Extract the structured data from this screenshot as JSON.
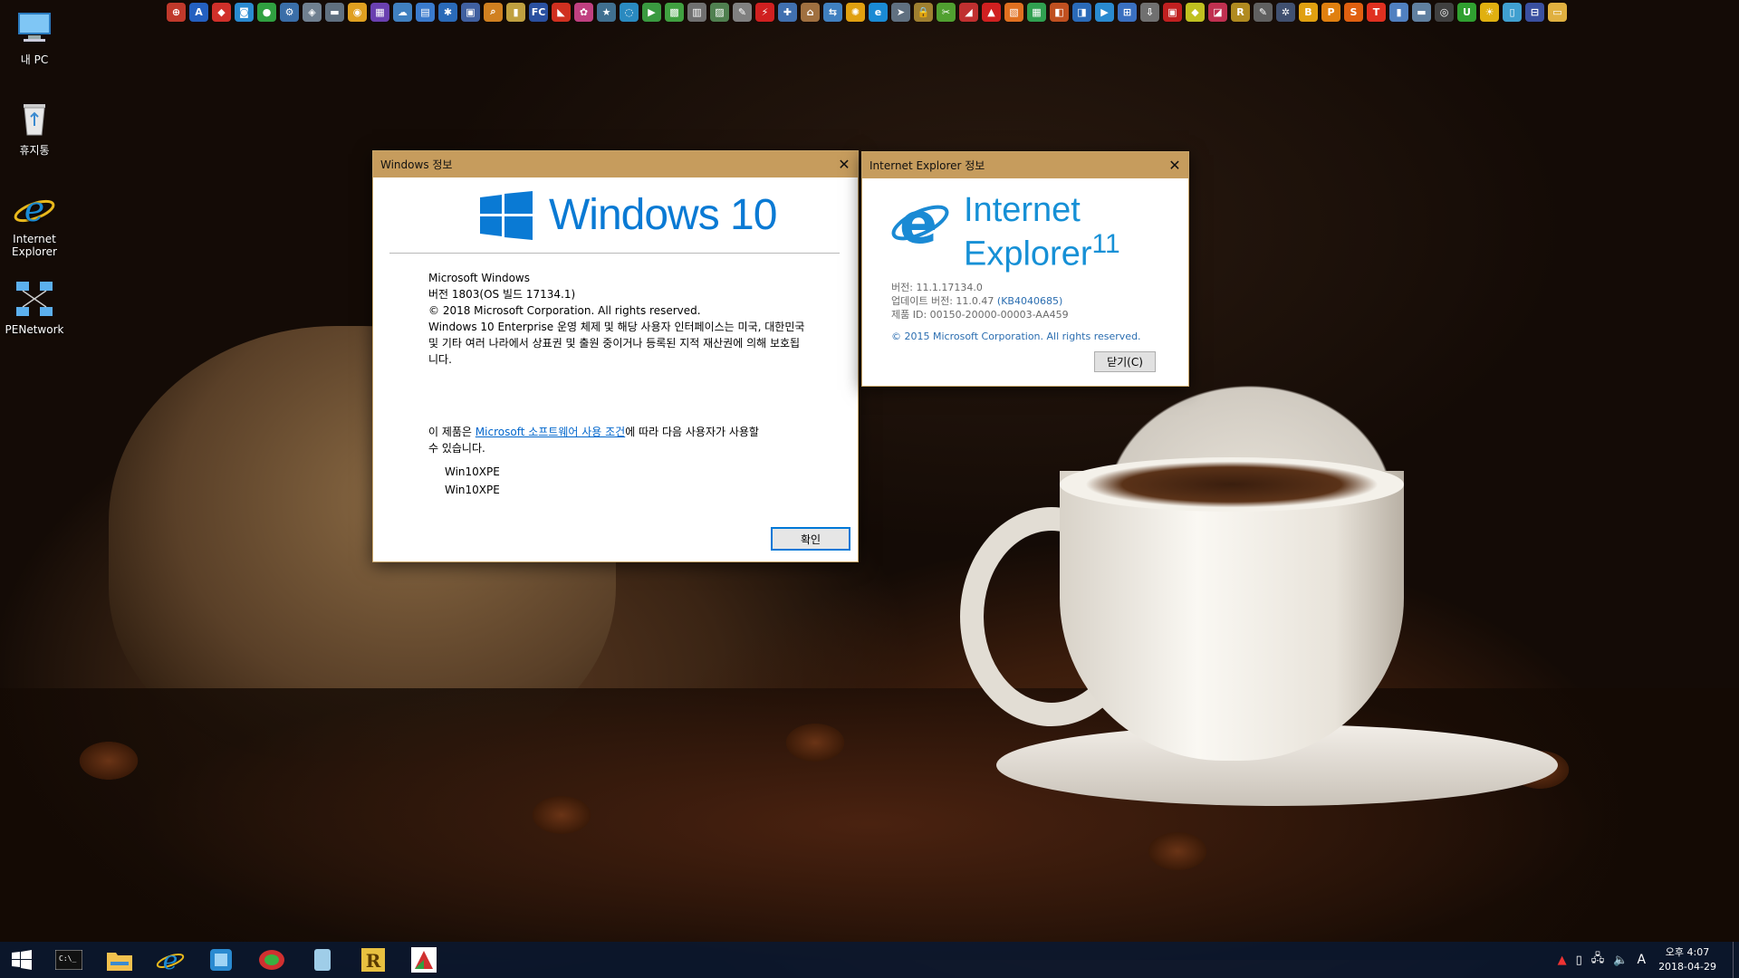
{
  "desktop": {
    "icons": [
      {
        "label": "내 PC",
        "icon": "this-pc-icon"
      },
      {
        "label": "휴지통",
        "icon": "recycle-bin-icon"
      },
      {
        "label": "Internet Explorer",
        "icon": "ie-icon"
      },
      {
        "label": "PENetwork",
        "icon": "network-icon"
      }
    ]
  },
  "toolbar": {
    "icons": [
      {
        "name": "app-icon",
        "glyph": "⊕",
        "color": "#c0392b"
      },
      {
        "name": "app-icon",
        "glyph": "A",
        "color": "#2460c0"
      },
      {
        "name": "app-icon",
        "glyph": "◆",
        "color": "#d0302a"
      },
      {
        "name": "app-icon",
        "glyph": "◙",
        "color": "#2a8ad0"
      },
      {
        "name": "app-icon",
        "glyph": "●",
        "color": "#30a040"
      },
      {
        "name": "app-icon",
        "glyph": "⚙",
        "color": "#3a6ea8"
      },
      {
        "name": "app-icon",
        "glyph": "◈",
        "color": "#708090"
      },
      {
        "name": "app-icon",
        "glyph": "▬",
        "color": "#607080"
      },
      {
        "name": "chrome-icon",
        "glyph": "◉",
        "color": "#e0a020"
      },
      {
        "name": "app-icon",
        "glyph": "▦",
        "color": "#6a40b0"
      },
      {
        "name": "app-icon",
        "glyph": "☁",
        "color": "#4080c0"
      },
      {
        "name": "app-icon",
        "glyph": "▤",
        "color": "#3a7acc"
      },
      {
        "name": "app-icon",
        "glyph": "✱",
        "color": "#2a6ab8"
      },
      {
        "name": "app-icon",
        "glyph": "▣",
        "color": "#4060a0"
      },
      {
        "name": "search-icon",
        "glyph": "⌕",
        "color": "#d08020"
      },
      {
        "name": "app-icon",
        "glyph": "▮",
        "color": "#c0a040"
      },
      {
        "name": "app-icon",
        "glyph": "FC",
        "color": "#2a50a0"
      },
      {
        "name": "app-icon",
        "glyph": "◣",
        "color": "#d03020"
      },
      {
        "name": "app-icon",
        "glyph": "✿",
        "color": "#c04080"
      },
      {
        "name": "app-icon",
        "glyph": "★",
        "color": "#407090"
      },
      {
        "name": "app-icon",
        "glyph": "◌",
        "color": "#2a8ac0"
      },
      {
        "name": "app-icon",
        "glyph": "▶",
        "color": "#3a9a40"
      },
      {
        "name": "app-icon",
        "glyph": "▩",
        "color": "#40a040"
      },
      {
        "name": "app-icon",
        "glyph": "▥",
        "color": "#707070"
      },
      {
        "name": "app-icon",
        "glyph": "▨",
        "color": "#508050"
      },
      {
        "name": "app-icon",
        "glyph": "✎",
        "color": "#808080"
      },
      {
        "name": "app-icon",
        "glyph": "⚡",
        "color": "#d02020"
      },
      {
        "name": "app-icon",
        "glyph": "✚",
        "color": "#4070b0"
      },
      {
        "name": "app-icon",
        "glyph": "⌂",
        "color": "#a07040"
      },
      {
        "name": "app-icon",
        "glyph": "⇆",
        "color": "#4080c0"
      },
      {
        "name": "app-icon",
        "glyph": "✺",
        "color": "#e0a010"
      },
      {
        "name": "ie-icon",
        "glyph": "e",
        "color": "#1a8ad4"
      },
      {
        "name": "app-icon",
        "glyph": "➤",
        "color": "#607080"
      },
      {
        "name": "lock-icon",
        "glyph": "🔒",
        "color": "#a08030"
      },
      {
        "name": "app-icon",
        "glyph": "✂",
        "color": "#50a030"
      },
      {
        "name": "app-icon",
        "glyph": "◢",
        "color": "#c03030"
      },
      {
        "name": "app-icon",
        "glyph": "▲",
        "color": "#d02020"
      },
      {
        "name": "app-icon",
        "glyph": "▧",
        "color": "#e07020"
      },
      {
        "name": "app-icon",
        "glyph": "▦",
        "color": "#30a050"
      },
      {
        "name": "app-icon",
        "glyph": "◧",
        "color": "#c05020"
      },
      {
        "name": "app-icon",
        "glyph": "◨",
        "color": "#2a6ab8"
      },
      {
        "name": "app-icon",
        "glyph": "▶",
        "color": "#2a8ad0"
      },
      {
        "name": "app-icon",
        "glyph": "⊞",
        "color": "#3a70c0"
      },
      {
        "name": "app-icon",
        "glyph": "⇩",
        "color": "#707070"
      },
      {
        "name": "app-icon",
        "glyph": "▣",
        "color": "#c02020"
      },
      {
        "name": "app-icon",
        "glyph": "◆",
        "color": "#c0c020"
      },
      {
        "name": "app-icon",
        "glyph": "◪",
        "color": "#c03050"
      },
      {
        "name": "app-icon",
        "glyph": "R",
        "color": "#b08a20"
      },
      {
        "name": "app-icon",
        "glyph": "✎",
        "color": "#606060"
      },
      {
        "name": "app-icon",
        "glyph": "✲",
        "color": "#405070"
      },
      {
        "name": "app-icon",
        "glyph": "B",
        "color": "#e0a010"
      },
      {
        "name": "app-icon",
        "glyph": "P",
        "color": "#e08010"
      },
      {
        "name": "app-icon",
        "glyph": "S",
        "color": "#e06010"
      },
      {
        "name": "app-icon",
        "glyph": "T",
        "color": "#e03020"
      },
      {
        "name": "app-icon",
        "glyph": "▮",
        "color": "#5080c0"
      },
      {
        "name": "app-icon",
        "glyph": "▬",
        "color": "#6080a0"
      },
      {
        "name": "app-icon",
        "glyph": "◎",
        "color": "#404040"
      },
      {
        "name": "app-icon",
        "glyph": "U",
        "color": "#30a030"
      },
      {
        "name": "app-icon",
        "glyph": "☀",
        "color": "#e0b010"
      },
      {
        "name": "app-icon",
        "glyph": "▯",
        "color": "#40a0d0"
      },
      {
        "name": "app-icon",
        "glyph": "⊟",
        "color": "#3a50a0"
      },
      {
        "name": "folder-icon",
        "glyph": "▭",
        "color": "#e0b040"
      }
    ]
  },
  "windows_about": {
    "title": "Windows 정보",
    "logo_text": "Windows 10",
    "product": "Microsoft Windows",
    "version": "버전 1803(OS 빌드 17134.1)",
    "copyright": "© 2018 Microsoft Corporation. All rights reserved.",
    "description": "Windows 10 Enterprise 운영 체제 및 해당 사용자 인터페이스는 미국, 대한민국 및 기타 여러 나라에서 상표권 및 출원 중이거나 등록된 지적 재산권에 의해 보호됩니다.",
    "license_prefix": "이 제품은 ",
    "license_link": "Microsoft 소프트웨어 사용 조건",
    "license_suffix": "에 따라 다음 사용자가 사용할 수 있습니다.",
    "users": [
      "Win10XPE",
      "Win10XPE"
    ],
    "ok_label": "확인"
  },
  "ie_about": {
    "title": "Internet Explorer 정보",
    "logo_line1": "Internet",
    "logo_line2": "Explorer",
    "logo_version": "11",
    "version": "버전: 11.1.17134.0",
    "update_prefix": "업데이트 버전: 11.0.47 ",
    "update_kb": "(KB4040685)",
    "product_id": "제품 ID: 00150-20000-00003-AA459",
    "copyright": "© 2015 Microsoft Corporation. All rights reserved.",
    "close_label": "닫기(C)"
  },
  "taskbar": {
    "items": [
      {
        "name": "start-button",
        "glyph": "⊞"
      },
      {
        "name": "cmd-icon",
        "glyph": "▭"
      },
      {
        "name": "file-explorer-icon",
        "glyph": "▬"
      },
      {
        "name": "ie-icon",
        "glyph": "e"
      },
      {
        "name": "app-icon",
        "glyph": "◙"
      },
      {
        "name": "app-icon",
        "glyph": "●"
      },
      {
        "name": "app-icon",
        "glyph": "▮"
      },
      {
        "name": "app-icon",
        "glyph": "R"
      },
      {
        "name": "app-icon",
        "glyph": "◣"
      }
    ],
    "tray_ime": "A",
    "clock_time": "오후 4:07",
    "clock_date": "2018-04-29"
  }
}
